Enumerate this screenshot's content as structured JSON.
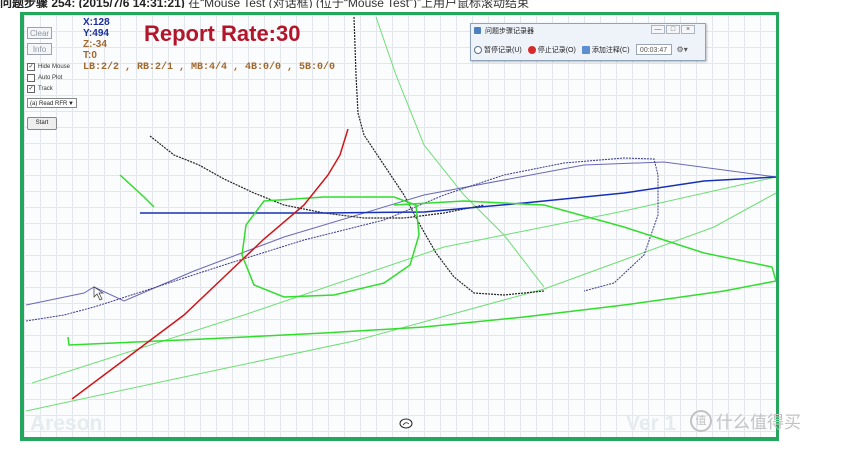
{
  "caption": {
    "step_label": "问题步骤 254: (2015/7/6 14:31:21)",
    "description": "在“Mouse Test (对话框) (位于“Mouse Test”)”上用户鼠标滚动结束"
  },
  "sidebar": {
    "clear_label": "Clear",
    "info_label": "Info",
    "checkboxes": [
      {
        "label": "Hide Mouse",
        "checked": true
      },
      {
        "label": "Auto Plot",
        "checked": false
      },
      {
        "label": "Track",
        "checked": true
      }
    ],
    "select_value": "(a) Read RFR",
    "start_label": "Start"
  },
  "readout": {
    "x": "X:128",
    "y": "Y:494",
    "z": "Z:-34",
    "t": "T:0",
    "buttons": "LB:2/2 , RB:2/1 , MB:4/4 , 4B:0/0 , 5B:0/0"
  },
  "report_rate": "Report Rate:30",
  "psr": {
    "title": "问题步骤记录器",
    "pause_label": "暂停记录(U)",
    "stop_label": "停止记录(O)",
    "comment_label": "添加注释(C)",
    "timer": "00:03:47",
    "minimize": "—",
    "maximize": "□",
    "close": "×"
  },
  "watermarks": {
    "left": "Areson",
    "right": "Ver 1",
    "site": "值 什么值得买",
    "site_icon_char": "值"
  },
  "colors": {
    "frame": "#24a75d",
    "title": "#b3162a",
    "x_color": "#1b2f9c",
    "y_color": "#1b2f9c",
    "z_color": "#a2672c",
    "t_color": "#a2672c",
    "bright_green": "#32dd2e",
    "light_green": "#74e07a",
    "navy": "#1730b8",
    "red": "#d01418"
  }
}
